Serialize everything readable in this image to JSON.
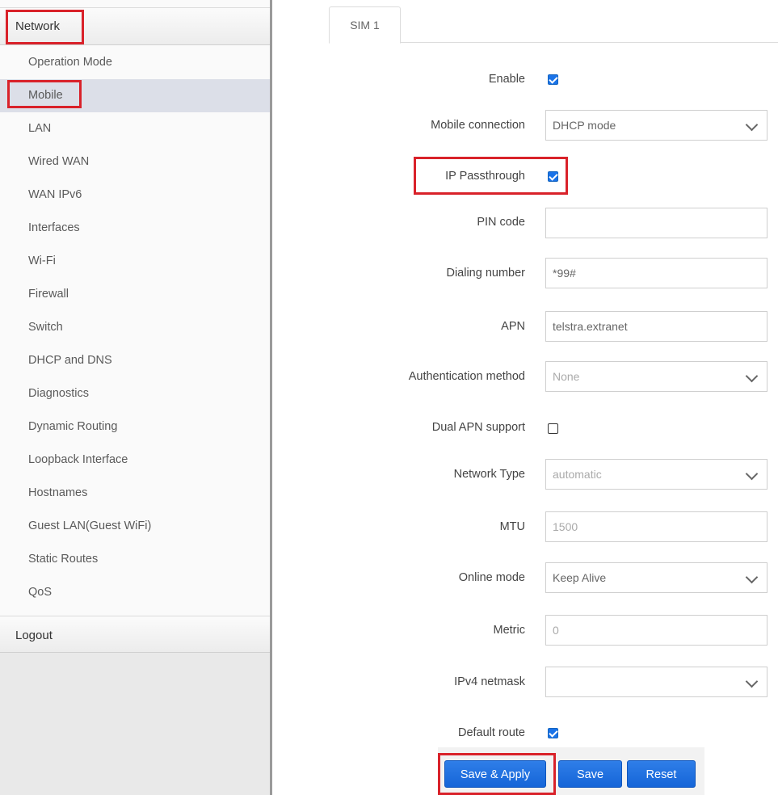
{
  "sidebar": {
    "section_title": "Network",
    "items": [
      {
        "label": "Operation Mode"
      },
      {
        "label": "Mobile"
      },
      {
        "label": "LAN"
      },
      {
        "label": "Wired WAN"
      },
      {
        "label": "WAN IPv6"
      },
      {
        "label": "Interfaces"
      },
      {
        "label": "Wi-Fi"
      },
      {
        "label": "Firewall"
      },
      {
        "label": "Switch"
      },
      {
        "label": "DHCP and DNS"
      },
      {
        "label": "Diagnostics"
      },
      {
        "label": "Dynamic Routing"
      },
      {
        "label": "Loopback Interface"
      },
      {
        "label": "Hostnames"
      },
      {
        "label": "Guest LAN(Guest WiFi)"
      },
      {
        "label": "Static Routes"
      },
      {
        "label": "QoS"
      }
    ],
    "active_item": "Mobile",
    "logout_label": "Logout"
  },
  "tabs": [
    {
      "label": "SIM 1",
      "active": true
    }
  ],
  "form": {
    "enable": {
      "label": "Enable",
      "checked": true
    },
    "mobile_connection": {
      "label": "Mobile connection",
      "value": "DHCP mode"
    },
    "ip_passthrough": {
      "label": "IP Passthrough",
      "checked": true
    },
    "pin_code": {
      "label": "PIN code",
      "value": ""
    },
    "dialing_number": {
      "label": "Dialing number",
      "value": "*99#"
    },
    "apn": {
      "label": "APN",
      "value": "telstra.extranet"
    },
    "auth_method": {
      "label": "Authentication method",
      "value": "None"
    },
    "dual_apn": {
      "label": "Dual APN support",
      "checked": false
    },
    "network_type": {
      "label": "Network Type",
      "value": "automatic"
    },
    "mtu": {
      "label": "MTU",
      "placeholder": "1500"
    },
    "online_mode": {
      "label": "Online mode",
      "value": "Keep Alive"
    },
    "metric": {
      "label": "Metric",
      "placeholder": "0"
    },
    "ipv4_netmask": {
      "label": "IPv4 netmask",
      "value": ""
    },
    "default_route": {
      "label": "Default route",
      "checked": true
    }
  },
  "buttons": {
    "save_apply": "Save & Apply",
    "save": "Save",
    "reset": "Reset"
  },
  "colors": {
    "highlight": "#d9222a",
    "accent": "#1a73e8",
    "active_menu_bg": "#dcdfe8"
  }
}
